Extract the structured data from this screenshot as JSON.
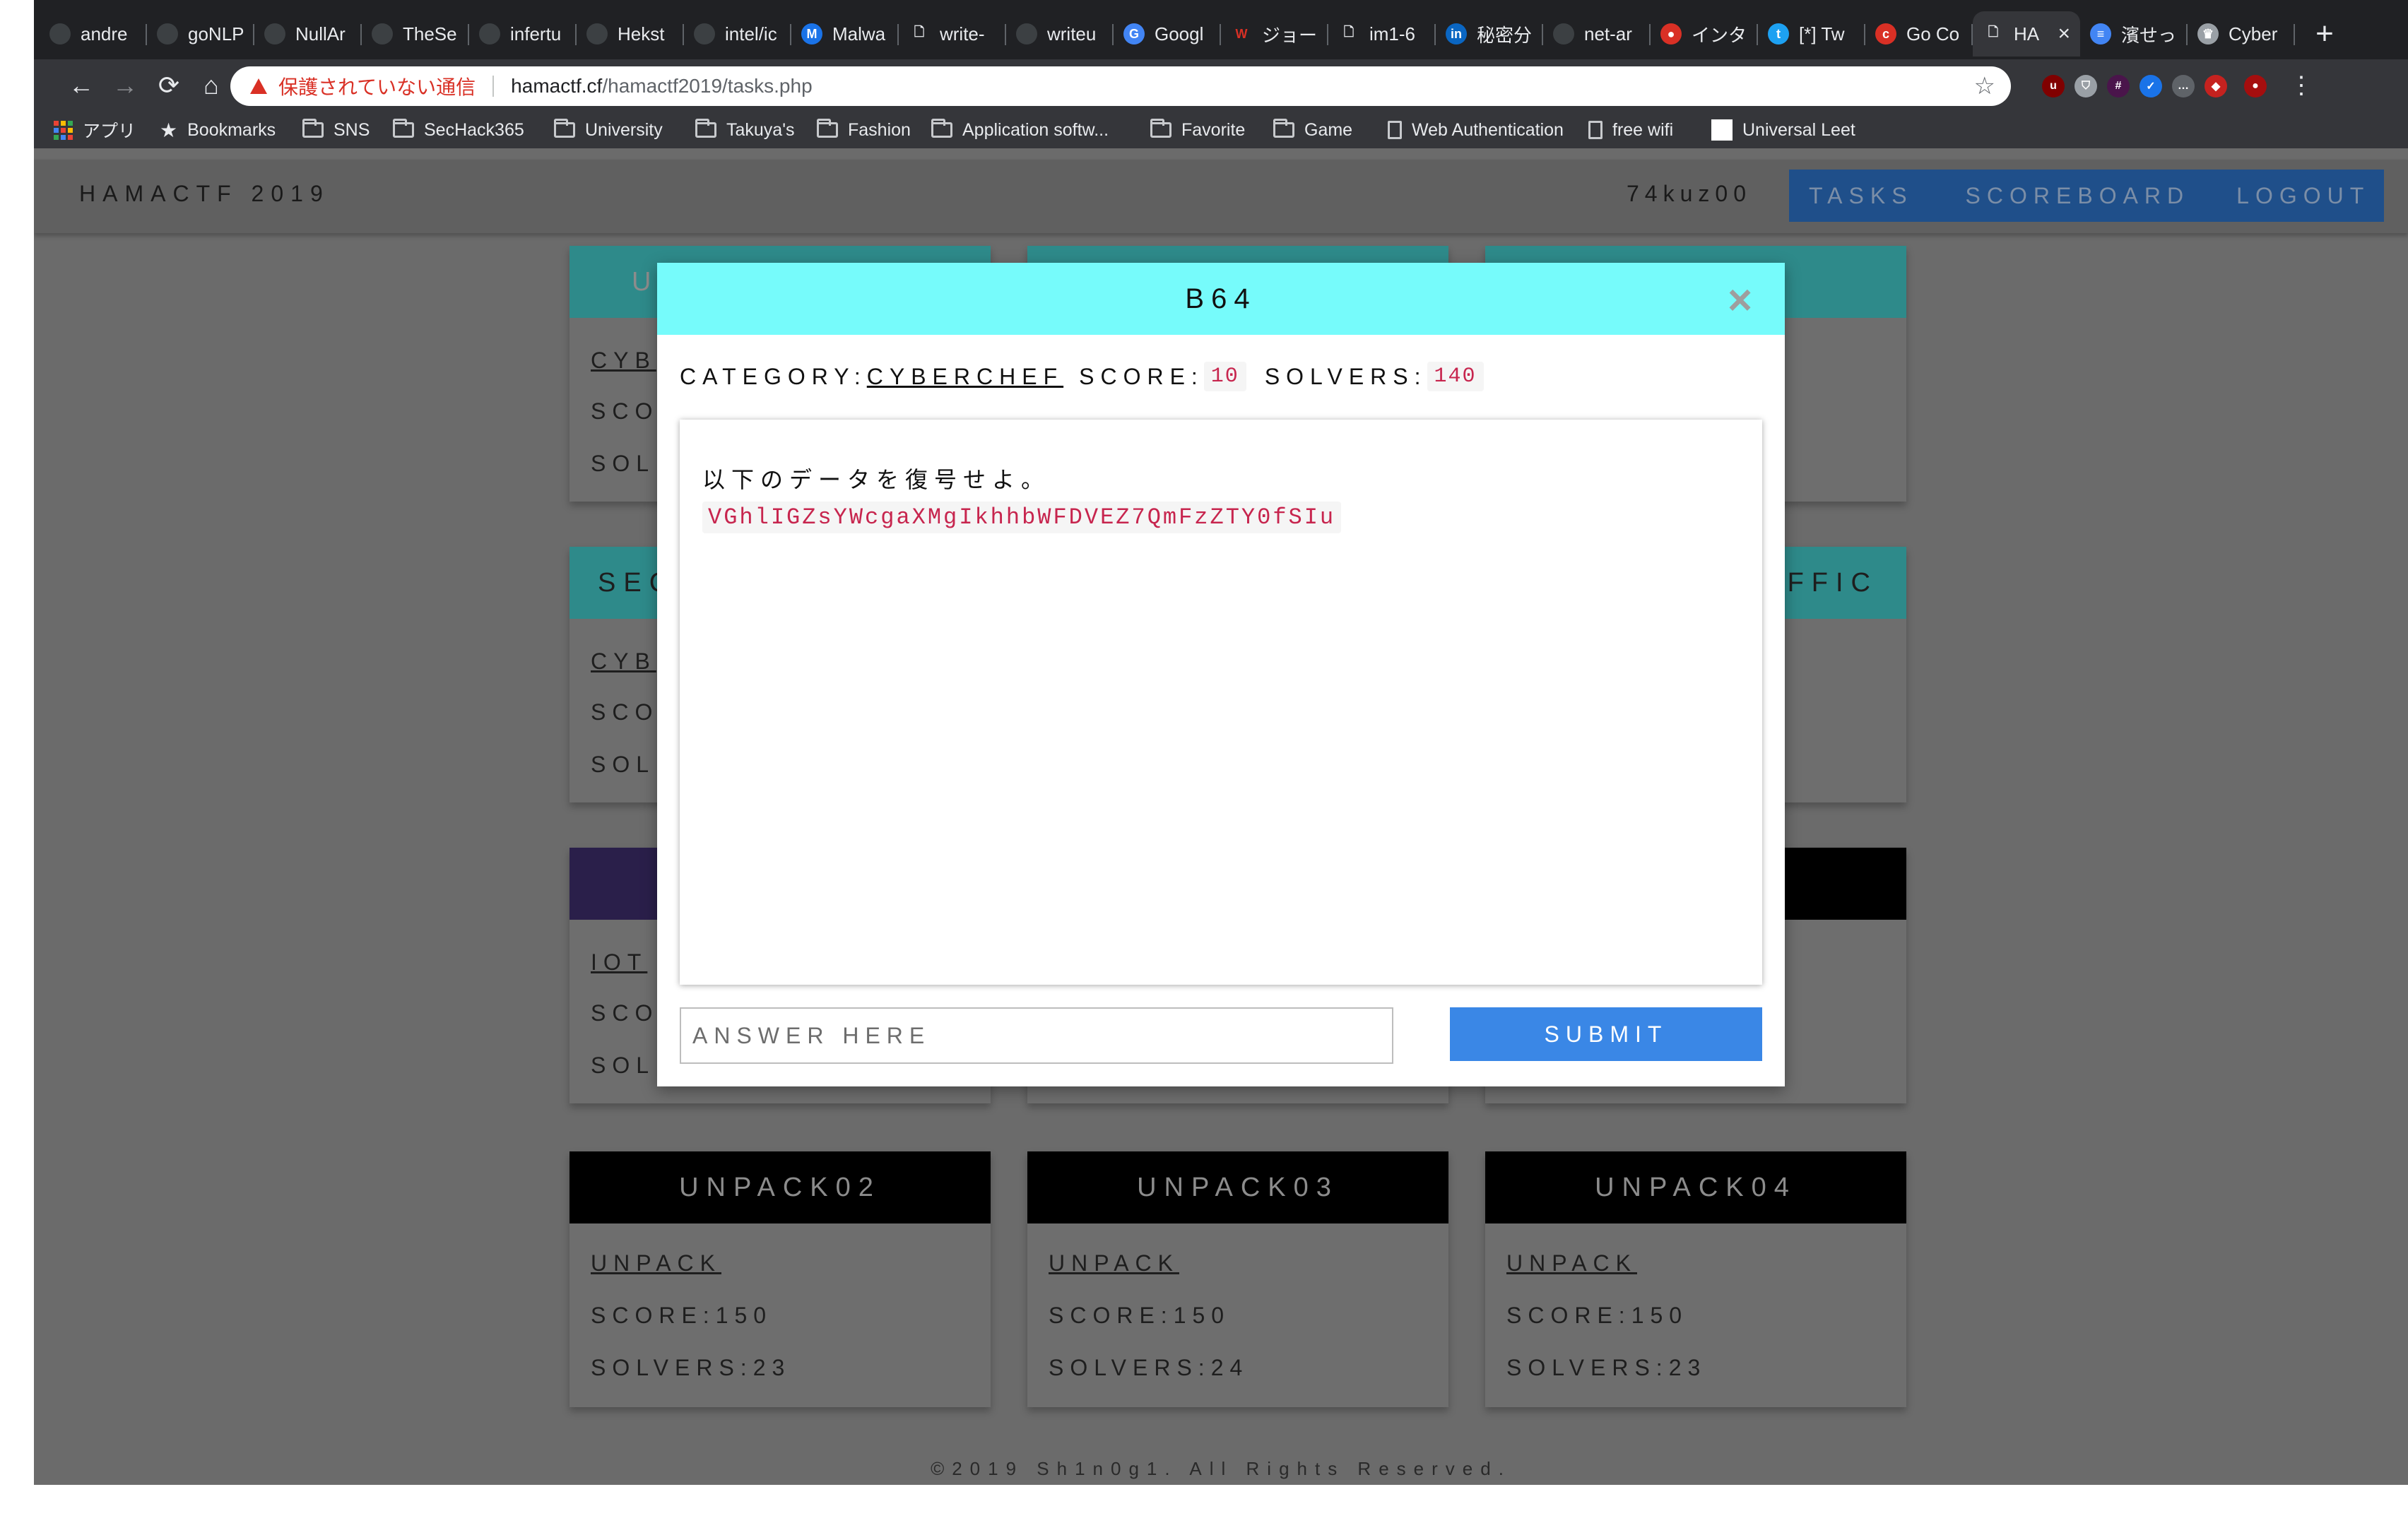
{
  "browser": {
    "tabs": [
      {
        "label": "andre",
        "icon": "github-icon"
      },
      {
        "label": "goNLP",
        "icon": "github-icon"
      },
      {
        "label": "NullAr",
        "icon": "github-icon"
      },
      {
        "label": "TheSe",
        "icon": "github-icon"
      },
      {
        "label": "infertu",
        "icon": "github-icon"
      },
      {
        "label": "Hekst",
        "icon": "github-icon"
      },
      {
        "label": "intel/ic",
        "icon": "github-icon"
      },
      {
        "label": "Malwa",
        "icon": "malware-icon"
      },
      {
        "label": "write-",
        "icon": "page-icon"
      },
      {
        "label": "writeu",
        "icon": "github-icon"
      },
      {
        "label": "Googl",
        "icon": "translate-icon"
      },
      {
        "label": "ジョー",
        "icon": "w-icon"
      },
      {
        "label": "im1-6",
        "icon": "page-icon"
      },
      {
        "label": "秘密分",
        "icon": "linkedin-icon"
      },
      {
        "label": "net-ar",
        "icon": "github-icon"
      },
      {
        "label": "インタ",
        "icon": "bug-icon"
      },
      {
        "label": "[*] Tw",
        "icon": "twitter-icon"
      },
      {
        "label": "Go Co",
        "icon": "c-icon"
      },
      {
        "label": "HA",
        "icon": "page-icon",
        "active": true
      },
      {
        "label": "濱せっ",
        "icon": "docs-icon"
      },
      {
        "label": "Cyber",
        "icon": "chef-icon"
      }
    ],
    "address": {
      "security_label": "保護されていない通信",
      "host": "hamactf.cf",
      "path": "/hamactf2019/tasks.php"
    },
    "bookmarks": [
      {
        "label": "アプリ",
        "icon": "apps-icon"
      },
      {
        "label": "Bookmarks",
        "icon": "star-icon"
      },
      {
        "label": "SNS",
        "icon": "folder-icon"
      },
      {
        "label": "SecHack365",
        "icon": "folder-icon"
      },
      {
        "label": "University",
        "icon": "folder-icon"
      },
      {
        "label": "Takuya's",
        "icon": "folder-icon"
      },
      {
        "label": "Fashion",
        "icon": "folder-icon"
      },
      {
        "label": "Application softw...",
        "icon": "folder-icon"
      },
      {
        "label": "Favorite",
        "icon": "folder-icon"
      },
      {
        "label": "Game",
        "icon": "folder-icon"
      },
      {
        "label": "Web Authentication",
        "icon": "page-icon"
      },
      {
        "label": "free wifi",
        "icon": "page-icon"
      },
      {
        "label": "Universal Leet",
        "icon": "white-square-icon"
      }
    ]
  },
  "site": {
    "brand": "HAMACTF 2019",
    "username": "74kuz00",
    "nav": [
      "TASKS",
      "SCOREBOARD",
      "LOGOUT"
    ],
    "footer": "©2019 Sh1n0g1. All Rights Reserved."
  },
  "cards_visible": [
    {
      "head": "U",
      "cat": "CYB",
      "score": "SCO",
      "solvers": "SOL"
    },
    {
      "head": "SEC",
      "cat": "CYB",
      "score": "SCO",
      "solvers": "SOL"
    },
    {
      "head": "",
      "cat": "IOT",
      "score": "SCO",
      "solvers": "SOL"
    },
    {
      "head": "FFIC"
    },
    {
      "head": "UNPACK02",
      "cat": "UNPACK",
      "score": "SCORE:150",
      "solvers": "SOLVERS:23"
    },
    {
      "head": "UNPACK03",
      "cat": "UNPACK",
      "score": "SCORE:150",
      "solvers": "SOLVERS:24"
    },
    {
      "head": "UNPACK04",
      "cat": "UNPACK",
      "score": "SCORE:150",
      "solvers": "SOLVERS:23"
    }
  ],
  "modal": {
    "title": "B64",
    "category_label": "CATEGORY:",
    "category": "CYBERCHEF",
    "score_label": "SCORE:",
    "score": "10",
    "solvers_label": "SOLVERS:",
    "solvers": "140",
    "description": "以下のデータを復号せよ。",
    "ciphertext": "VGhlIGZsYWcgaXMgIkhhbWFDVEZ7QmFzZTY0fSIu",
    "answer_placeholder": "ANSWER HERE",
    "answer_value": "",
    "submit_label": "SUBMIT",
    "close_glyph": "×"
  },
  "colors": {
    "modal_header": "#76fbfb",
    "submit": "#3a87e6",
    "code_text": "#c7254e",
    "nav_block": "#1f4f8a"
  }
}
